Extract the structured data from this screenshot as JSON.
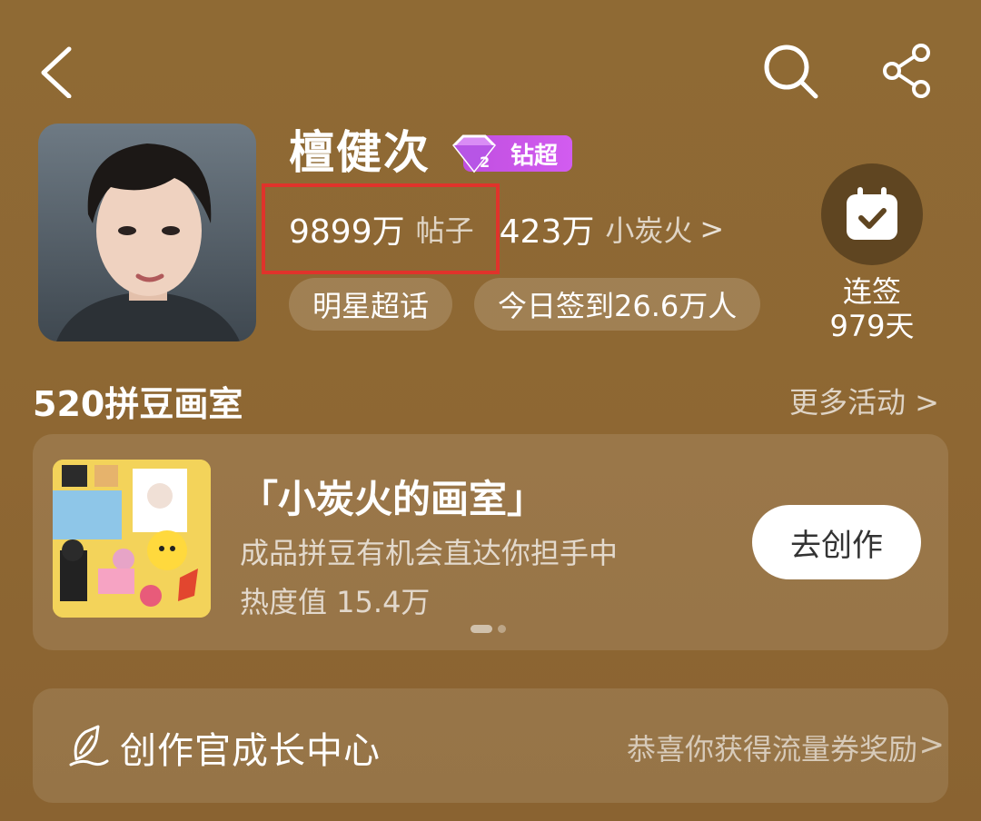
{
  "topbar": {
    "back_icon": "chevron-left-icon",
    "search_icon": "search-icon",
    "share_icon": "share-icon"
  },
  "profile": {
    "name": "檀健次",
    "badge_label": "钻超",
    "badge_level": "2",
    "posts_count": "9899万",
    "posts_label": "帖子",
    "fans_count": "423万",
    "fans_label": "小炭火",
    "fans_chevron": ">",
    "tag_category": "明星超话",
    "tag_checkin": "今日签到26.6万人",
    "checkin_label": "连签",
    "checkin_days": "979天"
  },
  "activity": {
    "section_title": "520拼豆画室",
    "more_label": "更多活动 >",
    "card_title": "「小炭火的画室」",
    "card_subtitle": "成品拼豆有机会直达你担手中",
    "card_heat": "热度值 15.4万",
    "button_label": "去创作",
    "carousel_pages": 2,
    "carousel_current": 1
  },
  "creator": {
    "title": "创作官成长中心",
    "reward_text": "恭喜你获得流量券奖励",
    "chevron": ">"
  },
  "colors": {
    "background": "#8f6a34",
    "highlight_box": "#e0332b",
    "badge": "#c04fe0"
  }
}
